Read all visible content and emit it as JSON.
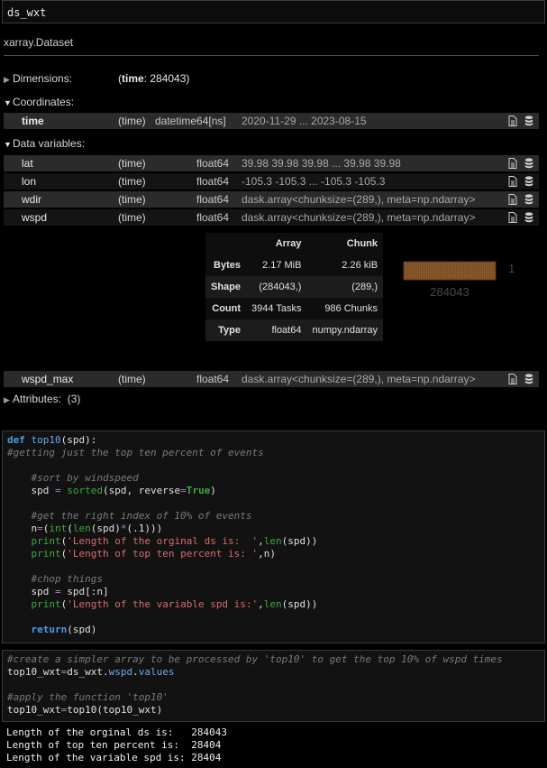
{
  "cell_top": {
    "code": "ds_wxt"
  },
  "output": {
    "title": "xarray.Dataset",
    "dimensions": {
      "label": "Dimensions:",
      "dim_name": "time",
      "dim_value": ": 284043"
    },
    "coordinates": {
      "label": "Coordinates:",
      "items": [
        {
          "name": "time",
          "dims": "(time)",
          "dtype": "datetime64[ns]",
          "preview": "2020-11-29 ... 2023-08-15"
        }
      ]
    },
    "data_variables": {
      "label": "Data variables:",
      "items": [
        {
          "name": "lat",
          "dims": "(time)",
          "dtype": "float64",
          "preview": "39.98 39.98 39.98 ... 39.98 39.98"
        },
        {
          "name": "lon",
          "dims": "(time)",
          "dtype": "float64",
          "preview": "-105.3 -105.3 ... -105.3 -105.3"
        },
        {
          "name": "wdir",
          "dims": "(time)",
          "dtype": "float64",
          "preview": "dask.array<chunksize=(289,), meta=np.ndarray>"
        },
        {
          "name": "wspd",
          "dims": "(time)",
          "dtype": "float64",
          "preview": "dask.array<chunksize=(289,), meta=np.ndarray>"
        },
        {
          "name": "wspd_max",
          "dims": "(time)",
          "dtype": "float64",
          "preview": "dask.array<chunksize=(289,), meta=np.ndarray>"
        }
      ]
    },
    "chunk_table": {
      "headers": [
        "",
        "Array",
        "Chunk"
      ],
      "rows": [
        {
          "label": "Bytes",
          "array": "2.17 MiB",
          "chunk": "2.26 kiB"
        },
        {
          "label": "Shape",
          "array": "(284043,)",
          "chunk": "(289,)"
        },
        {
          "label": "Count",
          "array": "3944 Tasks",
          "chunk": "986 Chunks"
        },
        {
          "label": "Type",
          "array": "float64",
          "chunk": "numpy.ndarray"
        }
      ],
      "diagram_width_label": "284043",
      "diagram_height_label": "1"
    },
    "attributes": {
      "label": "Attributes:",
      "count": "(3)"
    }
  },
  "cell_func": {
    "lines": [
      [
        [
          "kw",
          "def "
        ],
        [
          "fn",
          "top10"
        ],
        [
          "tx",
          "(spd):"
        ]
      ],
      [
        [
          "cm",
          "#getting just the top ten percent of events"
        ]
      ],
      [],
      [
        [
          "cm",
          "    #sort by windspeed"
        ]
      ],
      [
        [
          "tx",
          "    spd "
        ],
        [
          "op",
          "="
        ],
        [
          "tx",
          " "
        ],
        [
          "bi",
          "sorted"
        ],
        [
          "tx",
          "(spd, reverse"
        ],
        [
          "op",
          "="
        ],
        [
          "tr",
          "True"
        ],
        [
          "tx",
          ")"
        ]
      ],
      [],
      [
        [
          "cm",
          "    #get the right index of 10% of events"
        ]
      ],
      [
        [
          "tx",
          "    n"
        ],
        [
          "op",
          "="
        ],
        [
          "tx",
          "("
        ],
        [
          "bi",
          "int"
        ],
        [
          "tx",
          "("
        ],
        [
          "bi",
          "len"
        ],
        [
          "tx",
          "(spd)"
        ],
        [
          "op",
          "*"
        ],
        [
          "tx",
          "(.1)))"
        ]
      ],
      [
        [
          "tx",
          "    "
        ],
        [
          "bi",
          "print"
        ],
        [
          "tx",
          "("
        ],
        [
          "st",
          "'Length of the orginal ds is:  '"
        ],
        [
          "tx",
          ","
        ],
        [
          "bi",
          "len"
        ],
        [
          "tx",
          "(spd))"
        ]
      ],
      [
        [
          "tx",
          "    "
        ],
        [
          "bi",
          "print"
        ],
        [
          "tx",
          "("
        ],
        [
          "st",
          "'Length of top ten percent is: '"
        ],
        [
          "tx",
          ",n)"
        ]
      ],
      [],
      [
        [
          "cm",
          "    #chop things"
        ]
      ],
      [
        [
          "tx",
          "    spd "
        ],
        [
          "op",
          "="
        ],
        [
          "tx",
          " spd[:n]"
        ]
      ],
      [
        [
          "tx",
          "    "
        ],
        [
          "bi",
          "print"
        ],
        [
          "tx",
          "("
        ],
        [
          "st",
          "'Length of the variable spd is:'"
        ],
        [
          "tx",
          ","
        ],
        [
          "bi",
          "len"
        ],
        [
          "tx",
          "(spd))"
        ]
      ],
      [],
      [
        [
          "tx",
          "    "
        ],
        [
          "kw",
          "return"
        ],
        [
          "tx",
          "(spd)"
        ]
      ]
    ]
  },
  "cell_call": {
    "lines": [
      [
        [
          "cm",
          "#create a simpler array to be processed by 'top10' to get the top 10% of wspd times"
        ]
      ],
      [
        [
          "tx",
          "top10_wxt"
        ],
        [
          "op",
          "="
        ],
        [
          "tx",
          "ds_wxt."
        ],
        [
          "attr",
          "wspd"
        ],
        [
          "tx",
          "."
        ],
        [
          "attr",
          "values"
        ]
      ],
      [],
      [
        [
          "cm",
          "#apply the function 'top10'"
        ]
      ],
      [
        [
          "tx",
          "top10_wxt"
        ],
        [
          "op",
          "="
        ],
        [
          "tx",
          "top10(top10_wxt)"
        ]
      ]
    ]
  },
  "stdout": {
    "lines": [
      "Length of the orginal ds is:   284043",
      "Length of top ten percent is:  28404",
      "Length of the variable spd is: 28404"
    ]
  },
  "colors": {
    "background": "#000000",
    "row_alt": "#2b2b2b",
    "chunk_fill": "#8b5a2b"
  },
  "icons": [
    "file-text-icon",
    "database-icon",
    "triangle-right-icon",
    "triangle-down-icon"
  ]
}
